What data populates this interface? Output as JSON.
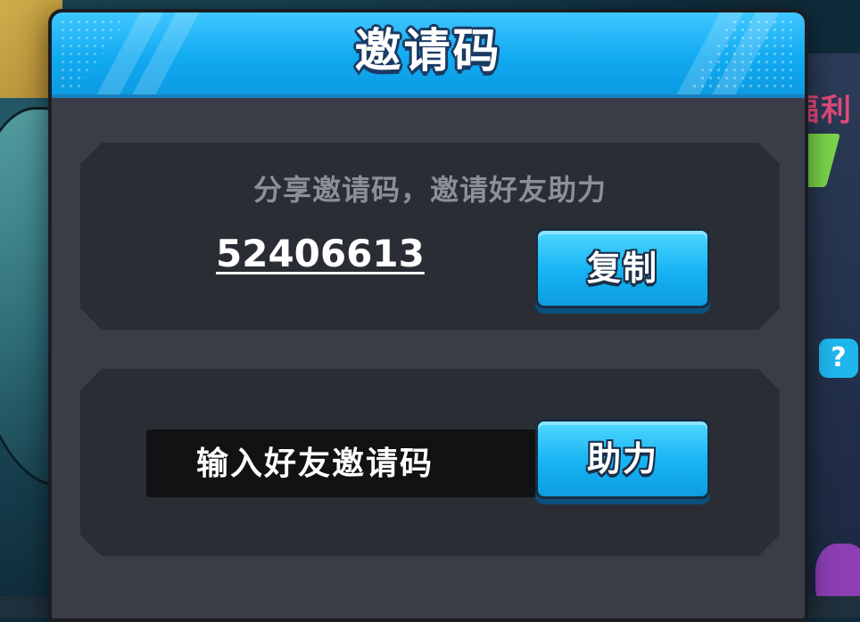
{
  "dialog": {
    "title": "邀请码"
  },
  "share_section": {
    "hint": "分享邀请码，邀请好友助力",
    "invite_code": "52406613",
    "copy_label": "复制"
  },
  "redeem_section": {
    "input_placeholder": "输入好友邀请码",
    "input_value": "",
    "assist_label": "助力"
  },
  "background": {
    "side_label": "福利",
    "badge_text": "?"
  },
  "colors": {
    "header_blue": "#12aaf1",
    "button_blue": "#16b3f3",
    "panel_bg": "#3a3d47",
    "section_bg": "#2b2d35",
    "input_bg": "#111214",
    "hint_gray": "#8c8f98"
  }
}
